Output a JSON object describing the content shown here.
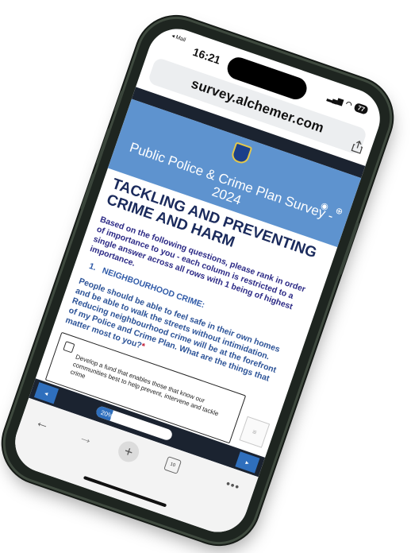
{
  "status": {
    "back_app": "◂ Mail",
    "time": "16:21",
    "battery": "77"
  },
  "browser": {
    "url": "survey.alchemer.com"
  },
  "banner": {
    "title": "Public Police & Crime Plan Survey - 2024"
  },
  "page": {
    "section_title": "TACKLING AND PREVENTING CRIME AND HARM",
    "instructions": "Based on the following questions, please rank in order of importance to you - each column is restricted to a single answer across all rows with 1 being of highest importance.",
    "question_number": "1.",
    "question_title": "NEIGHBOURHOOD CRIME:",
    "question_body": "People should be able to feel safe in their own homes and be able to walk the streets without intimidation. Reducing neighbourhood crime will be at the forefront of my Police and Crime Plan. What are the things that matter most to you?",
    "required_mark": "*"
  },
  "option": {
    "text": "Develop a fund that enables those that know our communities best to help prevent, intervene and tackle crime"
  },
  "progress": {
    "label": "20%",
    "value": 0.2
  },
  "toolbar": {
    "tabs_count": "10"
  }
}
